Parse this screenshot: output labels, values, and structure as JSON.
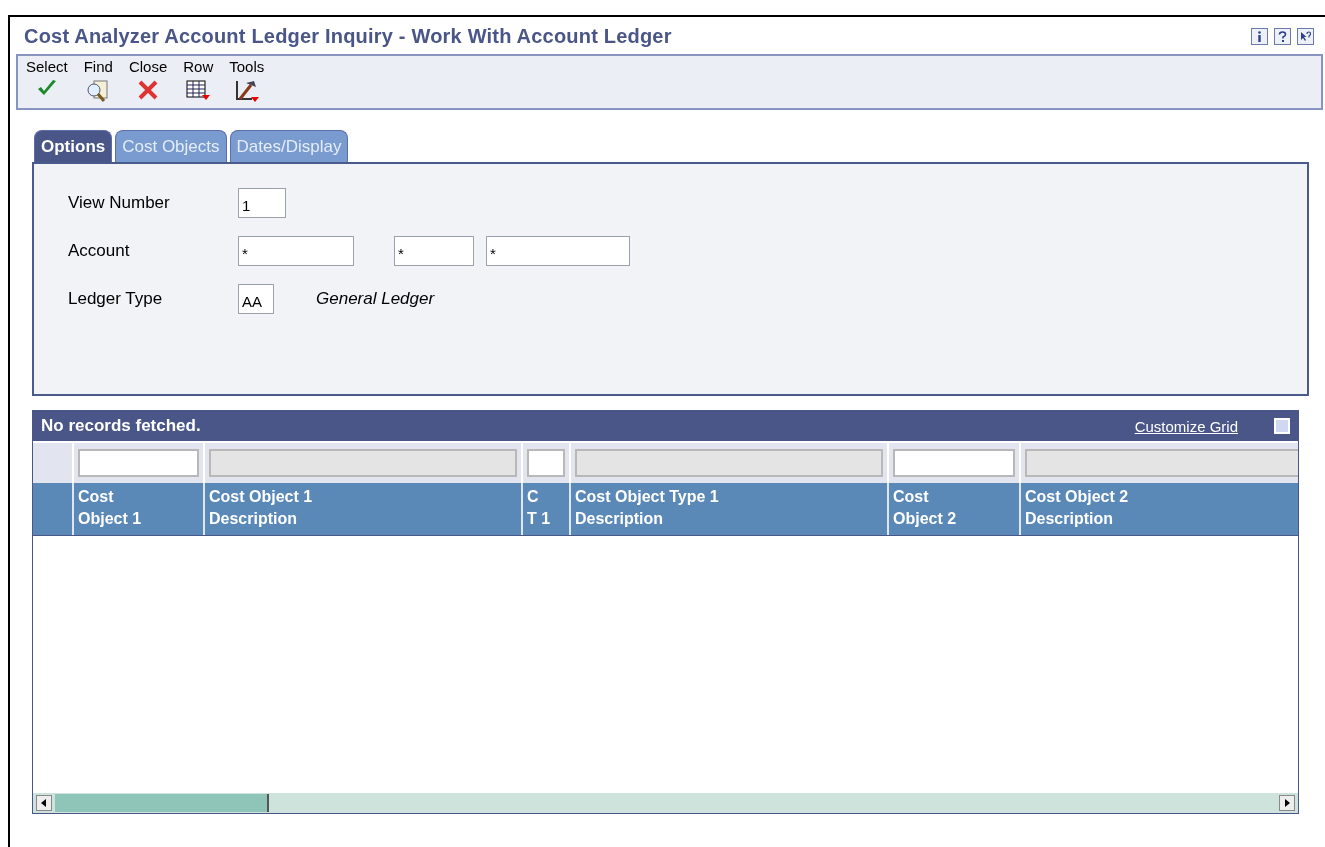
{
  "window": {
    "title": "Cost Analyzer Account Ledger Inquiry - Work With Account Ledger"
  },
  "toolbar": [
    {
      "label": "Select",
      "kind": "check"
    },
    {
      "label": "Find",
      "kind": "find"
    },
    {
      "label": "Close",
      "kind": "close"
    },
    {
      "label": "Row",
      "kind": "row"
    },
    {
      "label": "Tools",
      "kind": "tools"
    }
  ],
  "tabs": [
    {
      "label": "Options",
      "selected": true
    },
    {
      "label": "Cost Objects",
      "selected": false
    },
    {
      "label": "Dates/Display",
      "selected": false
    }
  ],
  "form": {
    "view_number": {
      "label": "View Number",
      "value": "1"
    },
    "account": {
      "label": "Account",
      "values": [
        "*",
        "*",
        "*"
      ]
    },
    "ledger_type": {
      "label": "Ledger Type",
      "value": "AA",
      "description": "General Ledger"
    }
  },
  "grid": {
    "status": "No records fetched.",
    "customize_link": "Customize Grid",
    "columns": [
      {
        "heading": [
          "Cost",
          "Object 1"
        ],
        "filter_disabled": false
      },
      {
        "heading": [
          "Cost Object 1",
          "Description"
        ],
        "filter_disabled": true
      },
      {
        "heading": [
          "C",
          "T 1"
        ],
        "filter_disabled": false
      },
      {
        "heading": [
          "Cost Object Type 1",
          "Description"
        ],
        "filter_disabled": true
      },
      {
        "heading": [
          "Cost",
          "Object 2"
        ],
        "filter_disabled": false
      },
      {
        "heading": [
          "Cost Object 2",
          "Description"
        ],
        "filter_disabled": true
      }
    ]
  }
}
